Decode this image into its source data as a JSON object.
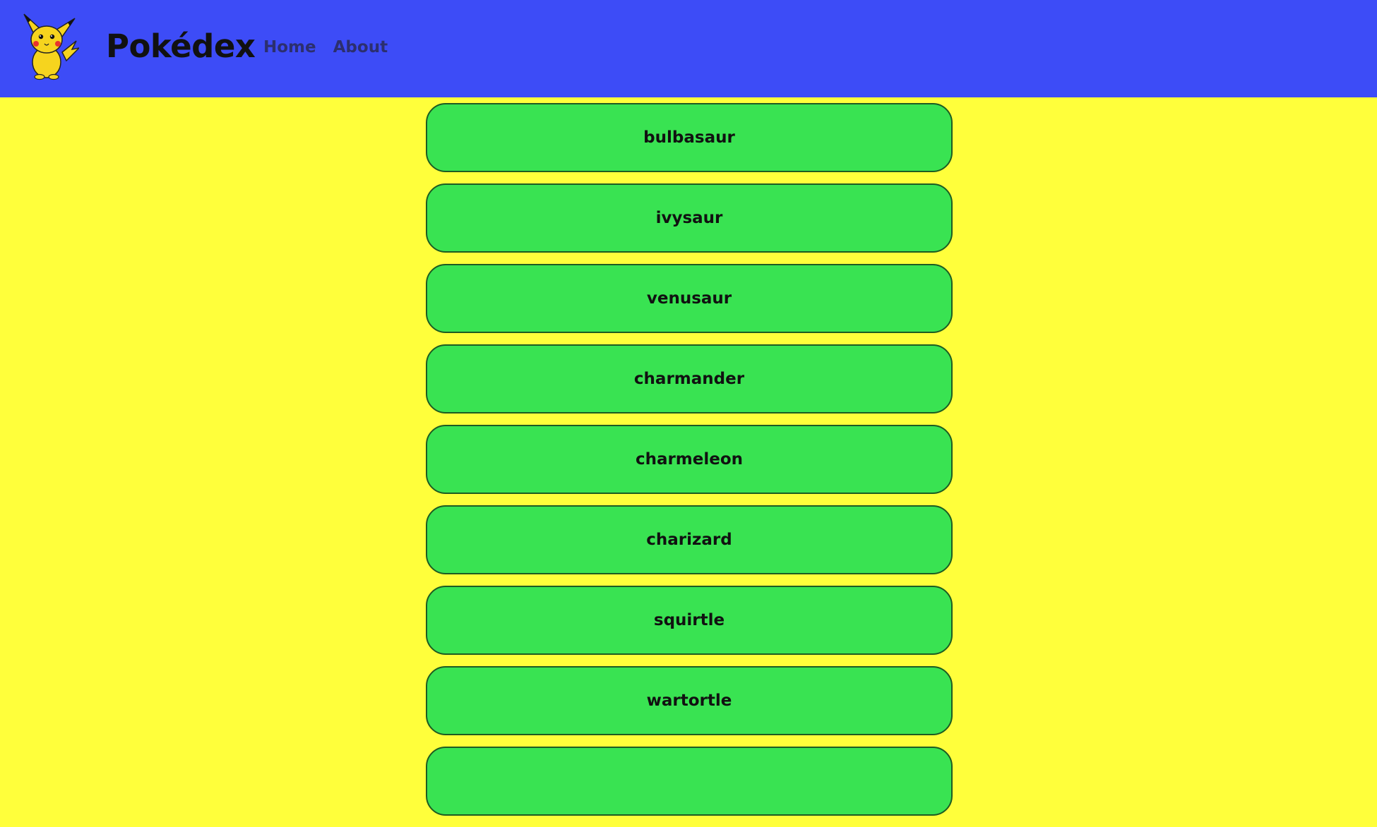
{
  "header": {
    "logo_icon": "pikachu-logo",
    "title": "Pokédex",
    "nav": [
      {
        "label": "Home"
      },
      {
        "label": "About"
      }
    ],
    "background_color": "#3d4cf7"
  },
  "page": {
    "background_color": "#ffff3b"
  },
  "pokemon_list": [
    {
      "name": "bulbasaur"
    },
    {
      "name": "ivysaur"
    },
    {
      "name": "venusaur"
    },
    {
      "name": "charmander"
    },
    {
      "name": "charmeleon"
    },
    {
      "name": "charizard"
    },
    {
      "name": "squirtle"
    },
    {
      "name": "wartortle"
    },
    {
      "name": ""
    }
  ],
  "card_color": "#39e352"
}
